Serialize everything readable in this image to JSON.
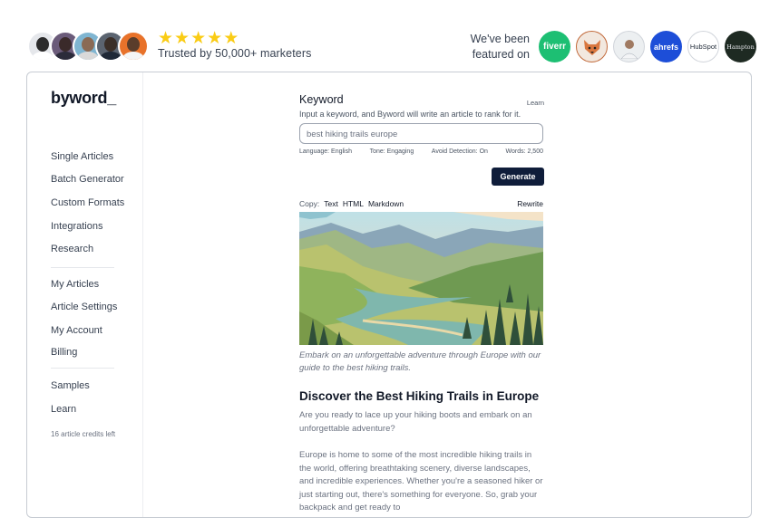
{
  "social_proof": {
    "avatars": [
      {
        "name": "avatar-1",
        "bg": "#e5e7eb",
        "head": "#2b2b2b",
        "body": "#ffffff"
      },
      {
        "name": "avatar-2",
        "bg": "#6b5b7a",
        "head": "#3a2a2a",
        "body": "#2b2b3a"
      },
      {
        "name": "avatar-3",
        "bg": "#7fb5d1",
        "head": "#8a6a55",
        "body": "#d9d9d9"
      },
      {
        "name": "avatar-4",
        "bg": "#5b6470",
        "head": "#3b2f28",
        "body": "#1f2937"
      },
      {
        "name": "avatar-5",
        "bg": "#e8722a",
        "head": "#5a3d2b",
        "body": "#f5f5f5"
      }
    ],
    "stars": [
      "★",
      "★",
      "★",
      "★",
      "★"
    ],
    "trusted_text": "Trusted by 50,000+ marketers"
  },
  "featured": {
    "label_line1": "We've been",
    "label_line2": "featured on",
    "logos": [
      {
        "text": "fiverr"
      },
      {
        "text": ""
      },
      {
        "text": ""
      },
      {
        "text": "ahrefs"
      },
      {
        "text": "HubSpot"
      },
      {
        "text": "Hampton"
      }
    ]
  },
  "sidebar": {
    "brand": "byword_",
    "items": [
      {
        "label": "Single Articles"
      },
      {
        "label": "Batch Generator"
      },
      {
        "label": "Custom Formats"
      },
      {
        "label": "Integrations"
      },
      {
        "label": "Research"
      },
      {
        "label": "My Articles"
      },
      {
        "label": "Article Settings"
      },
      {
        "label": "My Account"
      },
      {
        "label": "Billing"
      },
      {
        "label": "Samples"
      },
      {
        "label": "Learn"
      }
    ],
    "credits": "16 article credits left"
  },
  "main": {
    "keyword_title": "Keyword",
    "learn_link": "Learn",
    "description": "Input a keyword, and Byword will write an article to rank for it.",
    "keyword_value": "best hiking trails europe",
    "options": {
      "language": "Language: English",
      "tone": "Tone: Engaging",
      "detection": "Avoid Detection: On",
      "words": "Words: 2,500"
    },
    "generate_label": "Generate",
    "copy": {
      "label": "Copy:",
      "text": "Text",
      "html": "HTML",
      "markdown": "Markdown",
      "rewrite": "Rewrite"
    },
    "caption": "Embark on an unforgettable adventure through Europe with our guide to the best hiking trails.",
    "article_heading": "Discover the Best Hiking Trails in Europe",
    "para1": "Are you ready to lace up your hiking boots and embark on an unforgettable adventure?",
    "para2": "Europe is home to some of the most incredible hiking trails in the world, offering breathtaking scenery, diverse landscapes, and incredible experiences. Whether you're a seasoned hiker or just starting out, there's something for everyone. So, grab your backpack and get ready to"
  },
  "colors": {
    "accent": "#0f1d3a",
    "star": "#facc15",
    "fiverr": "#1dbf73",
    "ahrefs": "#1d4ed8"
  }
}
